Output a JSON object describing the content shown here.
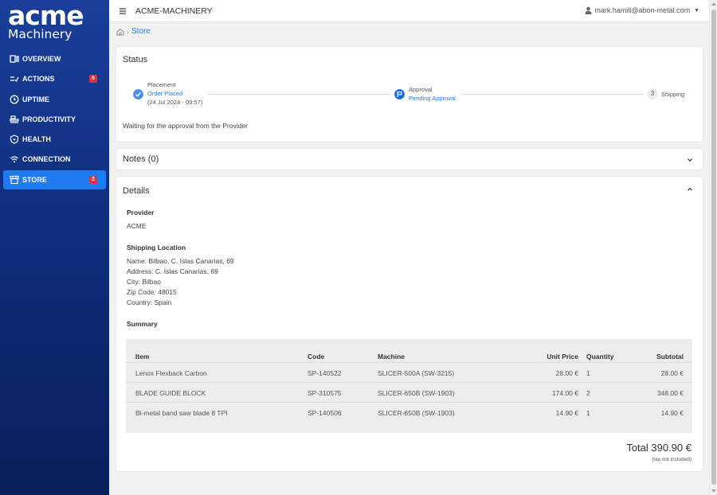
{
  "brand": {
    "name": "acme",
    "sub": "Machinery"
  },
  "nav": [
    {
      "label": "OVERVIEW",
      "icon": "overview-icon"
    },
    {
      "label": "ACTIONS",
      "icon": "actions-icon",
      "badge": "6"
    },
    {
      "label": "UPTIME",
      "icon": "uptime-icon"
    },
    {
      "label": "PRODUCTIVITY",
      "icon": "productivity-icon"
    },
    {
      "label": "HEALTH",
      "icon": "health-icon"
    },
    {
      "label": "CONNECTION",
      "icon": "connection-icon"
    },
    {
      "label": "STORE",
      "icon": "store-icon",
      "badge": "2",
      "active": true
    }
  ],
  "header": {
    "title": "ACME-MACHINERY",
    "user": "mark.hamill@abon-metal.com"
  },
  "breadcrumb": {
    "current": "Store"
  },
  "status": {
    "title": "Status",
    "steps": [
      {
        "label": "Placement",
        "sub": "Order Placed",
        "date": "(24 Jul 2024 - 09:57)"
      },
      {
        "label": "Approval",
        "sub": "Pending Approval"
      },
      {
        "num": "3",
        "label": "Shipping"
      }
    ],
    "message": "Waiting for the approval from the Provider"
  },
  "notes": {
    "title": "Notes (0)"
  },
  "details": {
    "title": "Details",
    "provider_label": "Provider",
    "provider": "ACME",
    "shipping_label": "Shipping Location",
    "shipping_lines": [
      "Name: Bilbao, C. Islas Canarias, 69",
      "Address: C. Islas Canarias, 69",
      "City: Bilbao",
      "Zip Code: 48015",
      "Country: Spain"
    ],
    "summary_label": "Summary",
    "table": {
      "headers": [
        "Item",
        "Code",
        "Machine",
        "Unit Price",
        "Quantity",
        "Subtotal"
      ],
      "rows": [
        [
          "Lenox Flexback Carbon",
          "SP-140522",
          "SLICER-500A (SW-3215)",
          "28.00 €",
          "1",
          "28.00 €"
        ],
        [
          "BLADE GUIDE BLOCK",
          "SP-310575",
          "SLICER-650B (SW-1903)",
          "174.00 €",
          "2",
          "348.00 €"
        ],
        [
          "Bi-metal band saw blade 8 TPI",
          "SP-140506",
          "SLICER-650B (SW-1903)",
          "14.90 €",
          "1",
          "14.90 €"
        ]
      ]
    },
    "total": "Total 390.90 €",
    "tax_note": "(tax not included)"
  },
  "colors": {
    "accent": "#1e7bf2",
    "sidebar": "#0f2e7d",
    "badge": "#e0313f"
  }
}
